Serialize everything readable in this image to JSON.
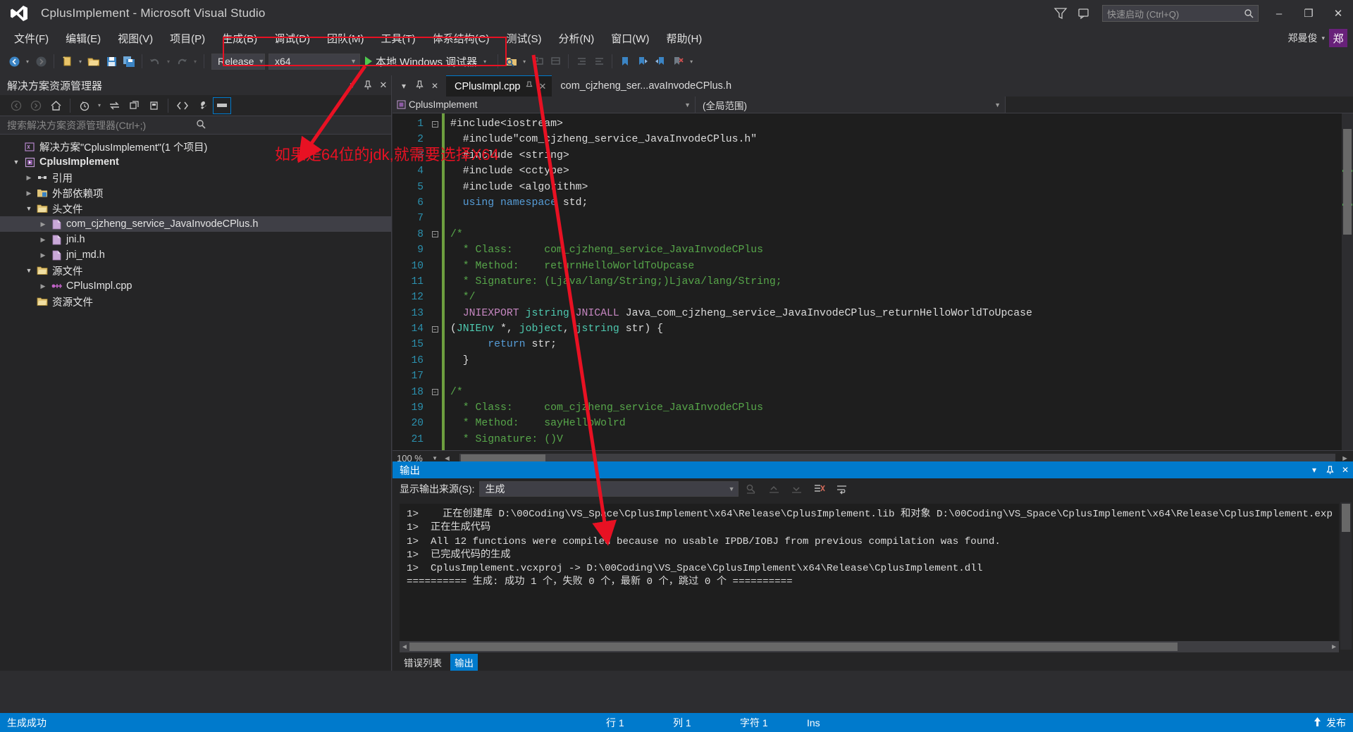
{
  "window": {
    "title": "CplusImplement - Microsoft Visual Studio",
    "logo_icon": "visual-studio-logo",
    "filter_icon": "feedback-icon",
    "feedback_icon": "notify-icon",
    "minimize": "–",
    "maximize": "❐",
    "close": "✕"
  },
  "quick_launch": {
    "placeholder": "快速启动 (Ctrl+Q)",
    "icon": "search-icon"
  },
  "user": {
    "name": "郑曼俊",
    "caret": "▾",
    "avatar_letter": "郑"
  },
  "menu": {
    "items": [
      {
        "label": "文件(F)"
      },
      {
        "label": "编辑(E)"
      },
      {
        "label": "视图(V)"
      },
      {
        "label": "项目(P)"
      },
      {
        "label": "生成(B)"
      },
      {
        "label": "调试(D)"
      },
      {
        "label": "团队(M)"
      },
      {
        "label": "工具(T)"
      },
      {
        "label": "体系结构(C)"
      },
      {
        "label": "测试(S)"
      },
      {
        "label": "分析(N)"
      },
      {
        "label": "窗口(W)"
      },
      {
        "label": "帮助(H)"
      }
    ]
  },
  "toolbar": {
    "nav_back_icon": "back-arrow-icon",
    "nav_forward_icon": "forward-arrow-icon",
    "new_item_icon": "new-file-icon",
    "open_icon": "open-folder-icon",
    "save_icon": "save-icon",
    "save_all_icon": "save-all-icon",
    "undo_icon": "undo-icon",
    "redo_icon": "redo-icon",
    "config_value": "Release",
    "platform_value": "x64",
    "run_label": "本地 Windows 调试器",
    "run_icon": "play-icon",
    "find_icon": "find-in-files-icon",
    "step_icons": [
      "step-into-icon",
      "step-over-icon",
      "step-out-icon",
      "indent-icon",
      "outdent-icon"
    ],
    "bookmark_icon": "bookmark-icon",
    "bookmark_next_icon": "bookmark-next-icon",
    "bookmark_prev_icon": "bookmark-prev-icon",
    "bookmark_clear_icon": "bookmark-clear-icon",
    "overflow_icon": "toolbar-overflow-icon"
  },
  "solution_explorer": {
    "title": "解决方案资源管理器",
    "dropdown_icon": "chevron-down-icon",
    "pin_icon": "pin-icon",
    "close_icon": "close-icon",
    "toolbar_icons": [
      "back-arrow-icon",
      "forward-arrow-icon",
      "home-icon",
      "pending-changes-icon",
      "sync-icon",
      "collapse-all-icon",
      "properties-icon",
      "show-all-files-icon",
      "refresh-icon",
      "view-code-icon",
      "properties-wrench-icon",
      "preview-pane-icon"
    ],
    "search_placeholder": "搜索解决方案资源管理器(Ctrl+;)",
    "search_icon": "search-icon",
    "tree": [
      {
        "label": "解决方案\"CplusImplement\"(1 个项目)",
        "icon": "solution-icon",
        "indent": 0,
        "arrow": "",
        "bold": false
      },
      {
        "label": "CplusImplement",
        "icon": "cpp-project-icon",
        "indent": 1,
        "arrow": "open",
        "bold": true
      },
      {
        "label": "引用",
        "icon": "references-icon",
        "indent": 2,
        "arrow": "closed",
        "bold": false
      },
      {
        "label": "外部依赖项",
        "icon": "external-deps-icon",
        "indent": 2,
        "arrow": "closed",
        "bold": false
      },
      {
        "label": "头文件",
        "icon": "folder-icon",
        "indent": 2,
        "arrow": "open",
        "bold": false
      },
      {
        "label": "com_cjzheng_service_JavaInvodeCPlus.h",
        "icon": "header-file-icon",
        "indent": 3,
        "arrow": "closed",
        "bold": false,
        "selected": true
      },
      {
        "label": "jni.h",
        "icon": "header-file-icon",
        "indent": 3,
        "arrow": "closed",
        "bold": false
      },
      {
        "label": "jni_md.h",
        "icon": "header-file-icon",
        "indent": 3,
        "arrow": "closed",
        "bold": false
      },
      {
        "label": "源文件",
        "icon": "folder-icon",
        "indent": 2,
        "arrow": "open",
        "bold": false
      },
      {
        "label": "CPlusImpl.cpp",
        "icon": "cpp-file-icon",
        "indent": 3,
        "arrow": "closed",
        "bold": false
      },
      {
        "label": "资源文件",
        "icon": "folder-icon",
        "indent": 2,
        "arrow": "",
        "bold": false
      }
    ]
  },
  "editor": {
    "pin_dropdown_icon": "chevron-down-icon",
    "pin_icon": "pin-icon",
    "close_icon": "close-icon",
    "tabs": [
      {
        "label": "CPlusImpl.cpp",
        "active": true,
        "pin_icon": "pin-icon",
        "close_icon": "close-icon"
      },
      {
        "label": "com_cjzheng_ser...avaInvodeCPlus.h",
        "active": false
      }
    ],
    "nav_scope": "CplusImplement",
    "nav_scope_icon": "cpp-project-icon",
    "nav_member": "(全局范围)",
    "zoom_level": "100 %",
    "lines": [
      {
        "n": 1,
        "fold": "minus",
        "segments": [
          {
            "t": "#include<iostream>",
            "c": "pp"
          }
        ]
      },
      {
        "n": 2,
        "fold": "",
        "segments": [
          {
            "t": "  #include\"com_cjzheng_service_JavaInvodeCPlus.h\"",
            "c": "pp"
          }
        ]
      },
      {
        "n": 3,
        "fold": "",
        "segments": [
          {
            "t": "  #include <string>",
            "c": "pp"
          }
        ]
      },
      {
        "n": 4,
        "fold": "",
        "segments": [
          {
            "t": "  #include <cctype>",
            "c": "pp"
          }
        ]
      },
      {
        "n": 5,
        "fold": "",
        "segments": [
          {
            "t": "  #include <algorithm>",
            "c": "pp"
          }
        ]
      },
      {
        "n": 6,
        "fold": "",
        "segments": [
          {
            "t": "  ",
            "c": "pp"
          },
          {
            "t": "using namespace",
            "c": "kw"
          },
          {
            "t": " std;",
            "c": "pp"
          }
        ]
      },
      {
        "n": 7,
        "fold": "",
        "segments": [
          {
            "t": "",
            "c": "pp"
          }
        ]
      },
      {
        "n": 8,
        "fold": "minus",
        "segments": [
          {
            "t": "/*",
            "c": "cm"
          }
        ]
      },
      {
        "n": 9,
        "fold": "",
        "segments": [
          {
            "t": "  * Class:     com_cjzheng_service_JavaInvodeCPlus",
            "c": "cm"
          }
        ]
      },
      {
        "n": 10,
        "fold": "",
        "segments": [
          {
            "t": "  * Method:    returnHelloWorldToUpcase",
            "c": "cm"
          }
        ]
      },
      {
        "n": 11,
        "fold": "",
        "segments": [
          {
            "t": "  * Signature: (Ljava/lang/String;)Ljava/lang/String;",
            "c": "cm"
          }
        ]
      },
      {
        "n": 12,
        "fold": "",
        "segments": [
          {
            "t": "  */",
            "c": "cm"
          }
        ]
      },
      {
        "n": 13,
        "fold": "",
        "segments": [
          {
            "t": "  ",
            "c": "pp"
          },
          {
            "t": "JNIEXPORT",
            "c": "mac"
          },
          {
            "t": " ",
            "c": "pp"
          },
          {
            "t": "jstring",
            "c": "typ"
          },
          {
            "t": " ",
            "c": "pp"
          },
          {
            "t": "JNICALL",
            "c": "mac"
          },
          {
            "t": " Java_com_cjzheng_service_JavaInvodeCPlus_returnHelloWorldToUpcase",
            "c": "pp"
          }
        ]
      },
      {
        "n": 14,
        "fold": "minus",
        "segments": [
          {
            "t": "(",
            "c": "pp"
          },
          {
            "t": "JNIEnv",
            "c": "typ"
          },
          {
            "t": " *, ",
            "c": "pp"
          },
          {
            "t": "jobject",
            "c": "typ"
          },
          {
            "t": ", ",
            "c": "pp"
          },
          {
            "t": "jstring",
            "c": "typ"
          },
          {
            "t": " str) {",
            "c": "pp"
          }
        ]
      },
      {
        "n": 15,
        "fold": "",
        "segments": [
          {
            "t": "      ",
            "c": "pp"
          },
          {
            "t": "return",
            "c": "kw"
          },
          {
            "t": " str;",
            "c": "pp"
          }
        ]
      },
      {
        "n": 16,
        "fold": "",
        "segments": [
          {
            "t": "  }",
            "c": "pp"
          }
        ]
      },
      {
        "n": 17,
        "fold": "",
        "segments": [
          {
            "t": "",
            "c": "pp"
          }
        ]
      },
      {
        "n": 18,
        "fold": "minus",
        "segments": [
          {
            "t": "/*",
            "c": "cm"
          }
        ]
      },
      {
        "n": 19,
        "fold": "",
        "segments": [
          {
            "t": "  * Class:     com_cjzheng_service_JavaInvodeCPlus",
            "c": "cm"
          }
        ]
      },
      {
        "n": 20,
        "fold": "",
        "segments": [
          {
            "t": "  * Method:    sayHelloWolrd",
            "c": "cm"
          }
        ]
      },
      {
        "n": 21,
        "fold": "",
        "segments": [
          {
            "t": "  * Signature: ()V",
            "c": "cm"
          }
        ]
      }
    ]
  },
  "output": {
    "title": "输出",
    "dropdown_icon": "chevron-down-icon",
    "pin_icon": "pin-icon",
    "close_icon": "close-icon",
    "source_label": "显示输出来源(S):",
    "source_value": "生成",
    "toolbar_icons": [
      "find-message-icon",
      "go-to-previous-icon",
      "go-to-next-icon",
      "clear-all-icon",
      "word-wrap-icon"
    ],
    "lines": [
      "1>    正在创建库 D:\\00Coding\\VS_Space\\CplusImplement\\x64\\Release\\CplusImplement.lib 和对象 D:\\00Coding\\VS_Space\\CplusImplement\\x64\\Release\\CplusImplement.exp",
      "1>  正在生成代码",
      "1>  All 12 functions were compiled because no usable IPDB/IOBJ from previous compilation was found.",
      "1>  已完成代码的生成",
      "1>  CplusImplement.vcxproj -> D:\\00Coding\\VS_Space\\CplusImplement\\x64\\Release\\CplusImplement.dll",
      "========== 生成: 成功 1 个，失败 0 个，最新 0 个，跳过 0 个 =========="
    ],
    "bottom_tabs": [
      {
        "label": "错误列表",
        "active": false
      },
      {
        "label": "输出",
        "active": true
      }
    ]
  },
  "status_bar": {
    "message": "生成成功",
    "row": "行 1",
    "col": "列 1",
    "char": "字符 1",
    "ins": "Ins",
    "publish": "发布",
    "publish_icon": "upload-arrow-icon"
  },
  "annotations": {
    "note_text": "如果是64位的jdk,就需要选择X64",
    "color": "#e81123"
  }
}
